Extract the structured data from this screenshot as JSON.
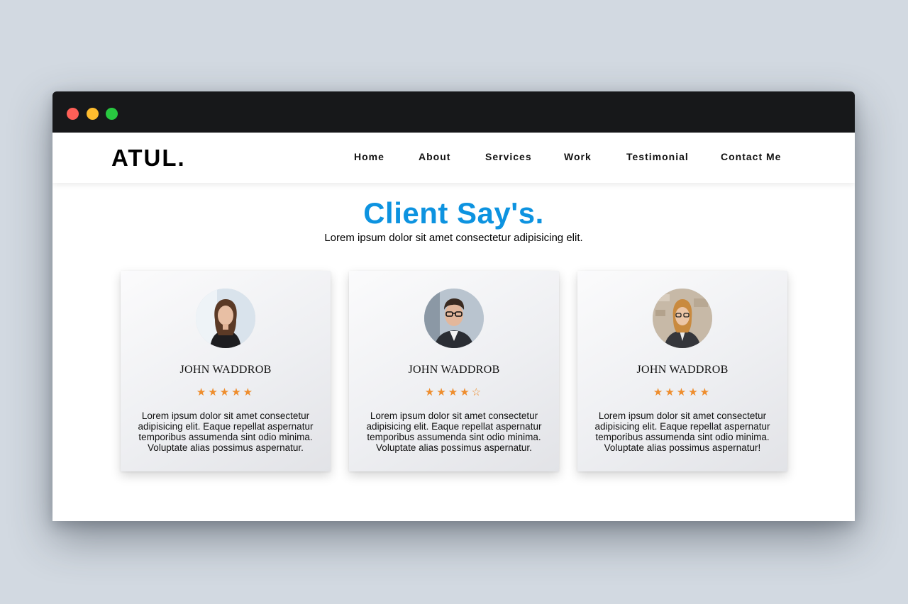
{
  "brand": {
    "logo": "ATUL."
  },
  "nav": {
    "links": [
      "Home",
      "About",
      "Services",
      "Work",
      "Testimonial",
      "Contact Me"
    ]
  },
  "section": {
    "title": "Client Say's.",
    "subtitle": "Lorem ipsum dolor sit amet consectetur adipisicing elit."
  },
  "testimonials": [
    {
      "name": "JOHN WADDROB",
      "rating": 5,
      "max_rating": 5,
      "text": "Lorem ipsum dolor sit amet consectetur adipisicing elit. Eaque repellat aspernatur temporibus assumenda sint odio minima. Voluptate alias possimus aspernatur."
    },
    {
      "name": "JOHN WADDROB",
      "rating": 4,
      "max_rating": 5,
      "text": "Lorem ipsum dolor sit amet consectetur adipisicing elit. Eaque repellat aspernatur temporibus assumenda sint odio minima. Voluptate alias possimus aspernatur."
    },
    {
      "name": "JOHN WADDROB",
      "rating": 5,
      "max_rating": 5,
      "text": "Lorem ipsum dolor sit amet consectetur adipisicing elit. Eaque repellat aspernatur temporibus assumenda sint odio minima. Voluptate alias possimus aspernatur!"
    }
  ],
  "colors": {
    "page_bg": "#d2d9e1",
    "titlebar": "#17181a",
    "accent_title": "#0d93e0",
    "star": "#ee8d2d",
    "dot_close": "#fe5f57",
    "dot_minimize": "#febc2e",
    "dot_maximize": "#28c840"
  },
  "icons": {
    "star_filled": "star-filled-icon",
    "star_empty": "star-outline-icon"
  }
}
